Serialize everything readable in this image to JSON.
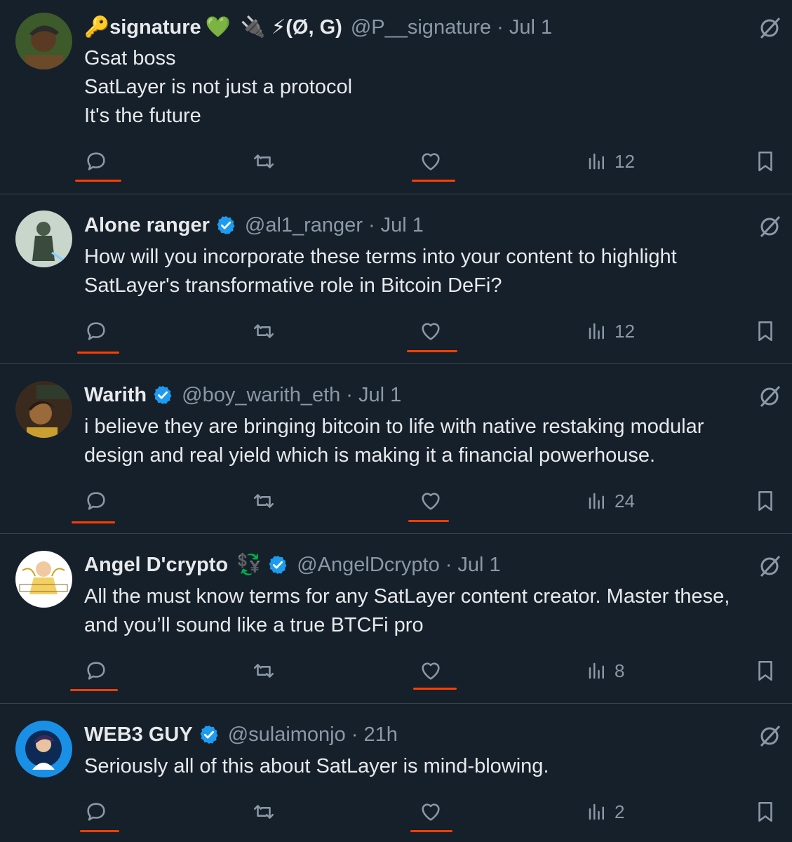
{
  "tweets": [
    {
      "name_prefix_emoji": "🔑",
      "name": "signature",
      "name_suffix_emoji": "💚",
      "name_extra": "🔌 ⚡(Ø, G)",
      "handle": "@P__signature",
      "time": "Jul 1",
      "verified": false,
      "lines": [
        "Gsat boss",
        "SatLayer is not just a protocol",
        "It's the future"
      ],
      "views": "12"
    },
    {
      "name": "Alone ranger",
      "handle": "@al1_ranger",
      "time": "Jul 1",
      "verified": true,
      "lines": [
        "How will you incorporate these terms into your content to highlight",
        "SatLayer's transformative role in Bitcoin DeFi?"
      ],
      "views": "12"
    },
    {
      "name": "Warith",
      "handle": "@boy_warith_eth",
      "time": "Jul 1",
      "verified": true,
      "lines": [
        "i believe they are bringing bitcoin  to life with native restaking modular",
        "design and real yield which is making it a financial powerhouse."
      ],
      "views": "24"
    },
    {
      "name": "Angel D'crypto",
      "name_extra": "💱",
      "handle": "@AngelDcrypto",
      "time": "Jul 1",
      "verified": true,
      "lines": [
        "All the must know terms for any SatLayer content creator. Master these,",
        "and you’ll sound like a true BTCFi pro"
      ],
      "views": "8"
    },
    {
      "name": "WEB3 GUY",
      "handle": "@sulaimonjo",
      "time": "21h",
      "verified": true,
      "lines": [
        "Seriously all of this about SatLayer is mind-blowing."
      ],
      "views": "2"
    }
  ],
  "dot": "·",
  "colors": {
    "background": "#15202b",
    "text": "#e7e9ea",
    "muted": "#8b98a5",
    "verified": "#1d9bf0",
    "annotation": "#ff3d00"
  }
}
